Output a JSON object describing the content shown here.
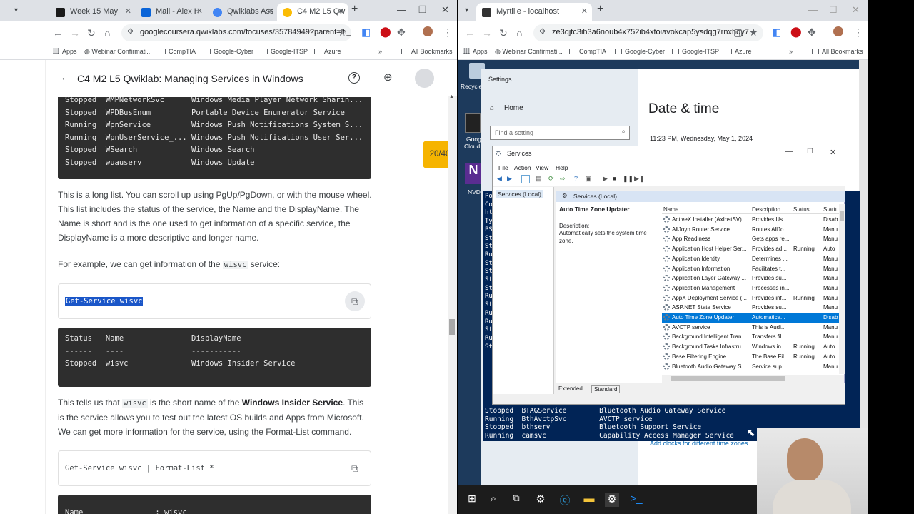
{
  "left_browser": {
    "tabs": [
      {
        "label": "Week 15 May",
        "color": "#1a1a1a"
      },
      {
        "label": "Mail - Alex H",
        "color": "#0a64d8"
      },
      {
        "label": "Qwiklabs Ass",
        "color": "#4285f4"
      },
      {
        "label": "C4 M2 L5 Qw",
        "color": "#fbbc04"
      }
    ],
    "url": "googlecoursera.qwiklabs.com/focuses/35784949?parent=lti_s...",
    "bookmarks": [
      "Apps",
      "Webinar Confirmati...",
      "CompTIA",
      "Google-Cyber",
      "Google-ITSP",
      "Azure"
    ],
    "all_bookmarks": "All Bookmarks",
    "lab_title": "C4 M2 L5 Qwiklab: Managing Services in Windows",
    "score": "20/40",
    "terminal1": [
      "Stopped  WMPNetworkSvc      Windows Media Player Network Sharin...",
      "Stopped  WPDBusEnum         Portable Device Enumerator Service",
      "Running  WpnService         Windows Push Notifications System S...",
      "Running  WpnUserService_... Windows Push Notifications User Ser...",
      "Stopped  WSearch            Windows Search",
      "Stopped  wuauserv           Windows Update"
    ],
    "para1": "This is a long list. You can scroll up using PgUp/PgDown, or with the mouse wheel. This list includes the status of the service, the Name and the DisplayName. The Name is short and is the one used to get information of a specific service, the DisplayName is a more descriptive and longer name.",
    "para2_pre": "For example, we can get information of the ",
    "para2_code": "wisvc",
    "para2_post": " service:",
    "code1": "Get-Service wisvc",
    "terminal2": [
      "",
      "Status   Name               DisplayName",
      "------   ----               -----------",
      "Stopped  wisvc              Windows Insider Service"
    ],
    "para3_a": "This tells us that ",
    "para3_code": "wisvc",
    "para3_b": " is the short name of the ",
    "para3_bold": "Windows Insider Service",
    "para3_c": ". This is the service allows you to test out the latest OS builds and Apps from Microsoft. We can get more information for the service, using the Format-List command.",
    "code2": "Get-Service wisvc | Format-List *",
    "terminal3": "Name                : wisvc"
  },
  "right_browser": {
    "tab": "Myrtille - localhost",
    "url": "ze3qjtc3ih3a6noub4x752ib4xtoiavokcap5ysdqg7rnxhqy7...",
    "bookmarks": [
      "Apps",
      "Webinar Confirmati...",
      "CompTIA",
      "Google-Cyber",
      "Google-ITSP",
      "Azure"
    ],
    "all_bookmarks": "All Bookmarks",
    "desktop_icons": [
      "Recycle",
      "Goog",
      "Cloud",
      "NVD"
    ],
    "settings": {
      "title": "Settings",
      "home": "Home",
      "search_placeholder": "Find a setting",
      "heading": "Date & time",
      "datetime": "11:23 PM, Wednesday, May 1, 2024",
      "link": "Add clocks for different time zones"
    },
    "services": {
      "title": "Services",
      "menu": [
        "File",
        "Action",
        "View",
        "Help"
      ],
      "tree": "Services (Local)",
      "header": "Services (Local)",
      "selected_name": "Auto Time Zone Updater",
      "desc_label": "Description:",
      "desc": "Automatically sets the system time zone.",
      "columns": [
        "Name",
        "Description",
        "Status",
        "Startu"
      ],
      "rows": [
        [
          "ActiveX Installer (AxInstSV)",
          "Provides Us...",
          "",
          "Disab"
        ],
        [
          "AllJoyn Router Service",
          "Routes AllJo...",
          "",
          "Manu"
        ],
        [
          "App Readiness",
          "Gets apps re...",
          "",
          "Manu"
        ],
        [
          "Application Host Helper Ser...",
          "Provides ad...",
          "Running",
          "Auto"
        ],
        [
          "Application Identity",
          "Determines ...",
          "",
          "Manu"
        ],
        [
          "Application Information",
          "Facilitates t...",
          "",
          "Manu"
        ],
        [
          "Application Layer Gateway ...",
          "Provides su...",
          "",
          "Manu"
        ],
        [
          "Application Management",
          "Processes in...",
          "",
          "Manu"
        ],
        [
          "AppX Deployment Service (...",
          "Provides inf...",
          "Running",
          "Manu"
        ],
        [
          "ASP.NET State Service",
          "Provides su...",
          "",
          "Manu"
        ],
        [
          "Auto Time Zone Updater",
          "Automatica...",
          "",
          "Disab"
        ],
        [
          "AVCTP service",
          "This is Audi...",
          "",
          "Manu"
        ],
        [
          "Background Intelligent Tran...",
          "Transfers fil...",
          "",
          "Manu"
        ],
        [
          "Background Tasks Infrastru...",
          "Windows in...",
          "Running",
          "Auto"
        ],
        [
          "Base Filtering Engine",
          "The Base Fil...",
          "Running",
          "Auto"
        ],
        [
          "Bluetooth Audio Gateway S...",
          "Service sup...",
          "",
          "Manu"
        ]
      ],
      "tabs": [
        "Extended",
        "Standard"
      ]
    },
    "ps_left": [
      "Po",
      "Co",
      "",
      "ht",
      "Ty",
      "",
      "PS",
      "",
      "St",
      "",
      "St",
      "Ru",
      "St",
      "St",
      "St",
      "St",
      "Ru",
      "St",
      "Ru",
      "Ru",
      "St",
      "Ru",
      "St"
    ],
    "powershell": [
      "Stopped  BTAGService        Bluetooth Audio Gateway Service",
      "Running  BthAvctpSvc        AVCTP service",
      "Stopped  bthserv            Bluetooth Support Service",
      "Running  camsvc             Capability Access Manager Service"
    ]
  }
}
